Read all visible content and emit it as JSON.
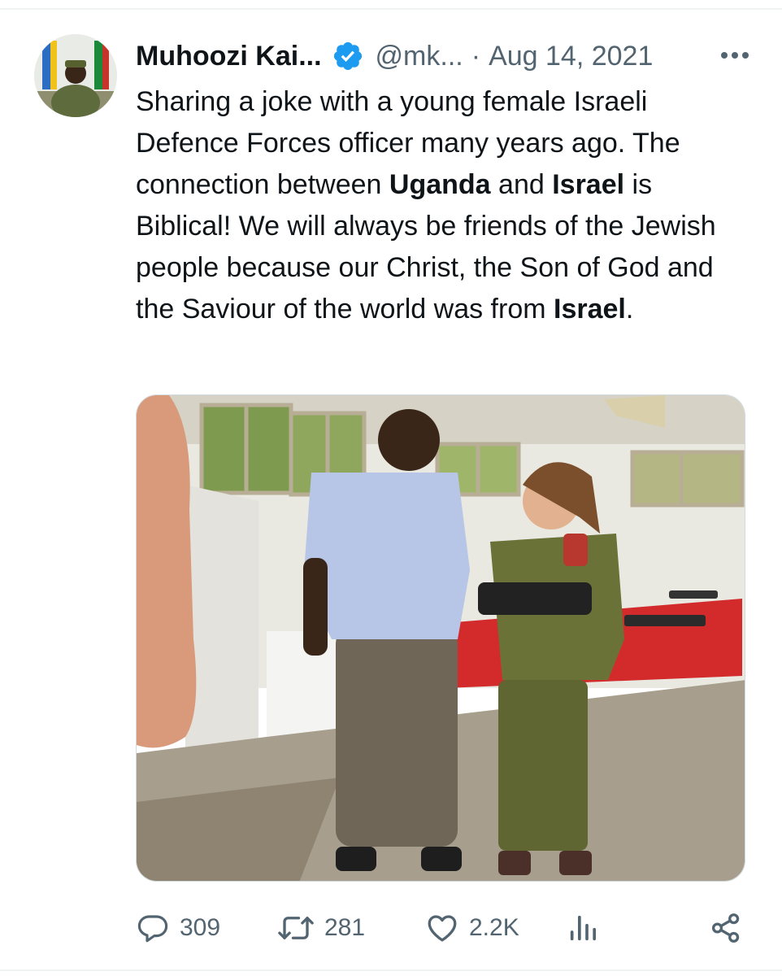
{
  "tweet": {
    "author_name": "Muhoozi Kai...",
    "handle": "@mk...",
    "separator": "·",
    "date": "Aug 14, 2021",
    "text_segments": [
      {
        "text": "Sharing a joke with a young female Israeli Defence Forces officer many years ago. The connection between ",
        "bold": false
      },
      {
        "text": "Uganda",
        "bold": true
      },
      {
        "text": " and ",
        "bold": false
      },
      {
        "text": "Israel",
        "bold": true
      },
      {
        "text": " is Biblical! We will always be friends of the Jewish people because our Christ, the Son of God and the Saviour of the world was from ",
        "bold": false
      },
      {
        "text": "Israel",
        "bold": true
      },
      {
        "text": ".",
        "bold": false
      }
    ]
  },
  "actions": {
    "replies": "309",
    "reposts": "281",
    "likes": "2.2K"
  },
  "icons": {
    "verified": "verified-badge-icon",
    "more": "more-options-icon",
    "reply": "reply-icon",
    "repost": "repost-icon",
    "like": "like-icon",
    "views": "views-icon",
    "share": "share-icon"
  },
  "colors": {
    "text": "#0f1419",
    "secondary": "#536471",
    "verified": "#1d9bf0",
    "divider": "#eff3f4"
  }
}
